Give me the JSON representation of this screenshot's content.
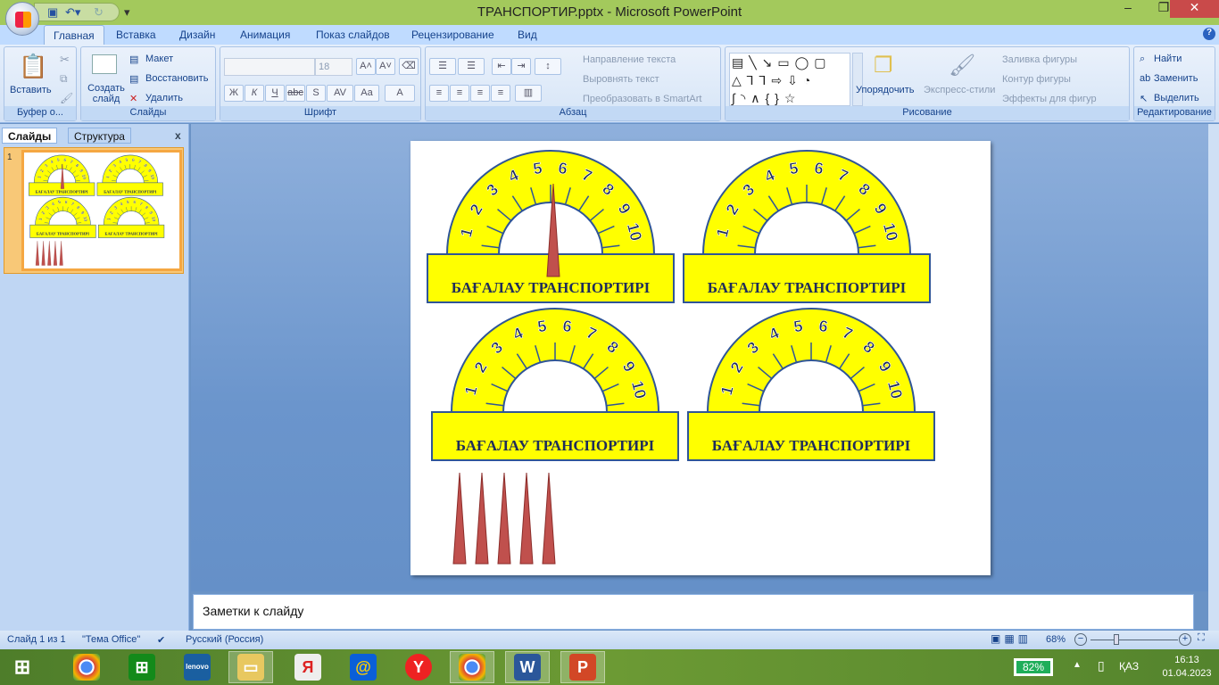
{
  "window": {
    "title": "ТРАНСПОРТИР.pptx - Microsoft PowerPoint",
    "minimize": "‒",
    "restore": "❐",
    "close": "✕"
  },
  "tabs": [
    "Главная",
    "Вставка",
    "Дизайн",
    "Анимация",
    "Показ слайдов",
    "Рецензирование",
    "Вид"
  ],
  "ribbon": {
    "clipboard": {
      "label": "Буфер о...",
      "paste": "Вставить"
    },
    "slides": {
      "label": "Слайды",
      "new_slide": "Создать слайд",
      "layout": "Макет",
      "reset": "Восстановить",
      "delete": "Удалить"
    },
    "font": {
      "label": "Шрифт",
      "font_name": "",
      "font_size": "18",
      "bold": "Ж",
      "italic": "К",
      "underline": "Ч",
      "strike": "abc",
      "shadow": "S",
      "spacing": "AV",
      "case": "Aa",
      "color": "A"
    },
    "paragraph": {
      "label": "Абзац",
      "text_direction": "Направление текста",
      "align_text": "Выровнять текст",
      "smartart": "Преобразовать в SmartArt"
    },
    "drawing": {
      "label": "Рисование",
      "arrange": "Упорядочить",
      "quick_styles": "Экспресс-стили",
      "fill": "Заливка фигуры",
      "outline": "Контур фигуры",
      "effects": "Эффекты для фигур"
    },
    "editing": {
      "label": "Редактирование",
      "find": "Найти",
      "replace": "Заменить",
      "select": "Выделить"
    }
  },
  "left_panel": {
    "tab_slides": "Слайды",
    "tab_outline": "Структура",
    "close": "x",
    "slide_number": "1"
  },
  "slide": {
    "protractor_label": "БАҒАЛАУ ТРАНСПОРТИРІ",
    "scale": [
      "1",
      "2",
      "3",
      "4",
      "5",
      "6",
      "7",
      "8",
      "9",
      "10"
    ],
    "colors": {
      "fill": "#ffff00",
      "outline": "#2f5597",
      "pointer": "#c0504d",
      "text": "#1f2d5a"
    },
    "pointers_loose": 5
  },
  "notes": {
    "placeholder": "Заметки к слайду"
  },
  "status": {
    "slide": "Слайд 1 из 1",
    "theme": "\"Тема Office\"",
    "language": "Русский (Россия)",
    "zoom": "68%",
    "zoom_percent": 68
  },
  "taskbar": {
    "battery": "82%",
    "lang": "ҚАЗ",
    "time": "16:13",
    "date": "01.04.2023",
    "apps": [
      "chrome",
      "store",
      "lenovo",
      "explorer",
      "yandex-browser",
      "mail",
      "yandex",
      "chrome-profile",
      "word",
      "powerpoint"
    ]
  }
}
